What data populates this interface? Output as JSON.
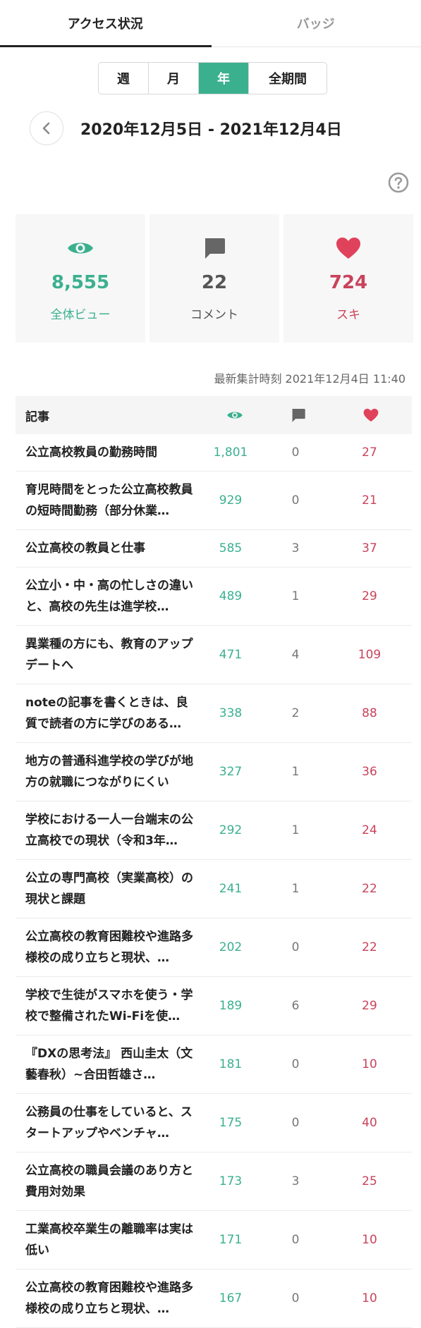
{
  "tabs": {
    "access": "アクセス状況",
    "badges": "バッジ"
  },
  "period": {
    "week": "週",
    "month": "月",
    "year": "年",
    "all": "全期間",
    "selected": "年"
  },
  "date_range": "2020年12月5日 - 2021年12月4日",
  "icons": {
    "back": "chevron-left-icon",
    "help": "question-icon",
    "views": "eye-icon",
    "comments": "comment-icon",
    "likes": "heart-icon"
  },
  "stats": {
    "views": {
      "value": "8,555",
      "label": "全体ビュー"
    },
    "comments": {
      "value": "22",
      "label": "コメント"
    },
    "likes": {
      "value": "724",
      "label": "スキ"
    }
  },
  "updated": "最新集計時刻 2021年12月4日 11:40",
  "table": {
    "header_title": "記事",
    "rows": [
      {
        "title": "公立高校教員の勤務時間",
        "views": "1,801",
        "comments": "0",
        "likes": "27"
      },
      {
        "title": "育児時間をとった公立高校教員の短時間勤務（部分休業…",
        "views": "929",
        "comments": "0",
        "likes": "21"
      },
      {
        "title": "公立高校の教員と仕事",
        "views": "585",
        "comments": "3",
        "likes": "37"
      },
      {
        "title": "公立小・中・高の忙しさの違いと、高校の先生は進学校…",
        "views": "489",
        "comments": "1",
        "likes": "29"
      },
      {
        "title": "異業種の方にも、教育のアップデートへ",
        "views": "471",
        "comments": "4",
        "likes": "109"
      },
      {
        "title": "noteの記事を書くときは、良質で読者の方に学びのある…",
        "views": "338",
        "comments": "2",
        "likes": "88"
      },
      {
        "title": "地方の普通科進学校の学びが地方の就職につながりにくい",
        "views": "327",
        "comments": "1",
        "likes": "36"
      },
      {
        "title": "学校における一人一台端末の公立高校での現状（令和3年…",
        "views": "292",
        "comments": "1",
        "likes": "24"
      },
      {
        "title": "公立の専門高校（実業高校）の現状と課題",
        "views": "241",
        "comments": "1",
        "likes": "22"
      },
      {
        "title": "公立高校の教育困難校や進路多様校の成り立ちと現状、…",
        "views": "202",
        "comments": "0",
        "likes": "22"
      },
      {
        "title": "学校で生徒がスマホを使う・学校で整備されたWi-Fiを使…",
        "views": "189",
        "comments": "6",
        "likes": "29"
      },
      {
        "title": "『DXの思考法』 西山圭太（文藝春秋）~合田哲雄さ…",
        "views": "181",
        "comments": "0",
        "likes": "10"
      },
      {
        "title": "公務員の仕事をしていると、スタートアップやベンチャ…",
        "views": "175",
        "comments": "0",
        "likes": "40"
      },
      {
        "title": "公立高校の職員会議のあり方と費用対効果",
        "views": "173",
        "comments": "3",
        "likes": "25"
      },
      {
        "title": "工業高校卒業生の離職率は実は低い",
        "views": "171",
        "comments": "0",
        "likes": "10"
      },
      {
        "title": "公立高校の教育困難校や進路多様校の成り立ちと現状、…",
        "views": "167",
        "comments": "0",
        "likes": "10"
      }
    ]
  }
}
